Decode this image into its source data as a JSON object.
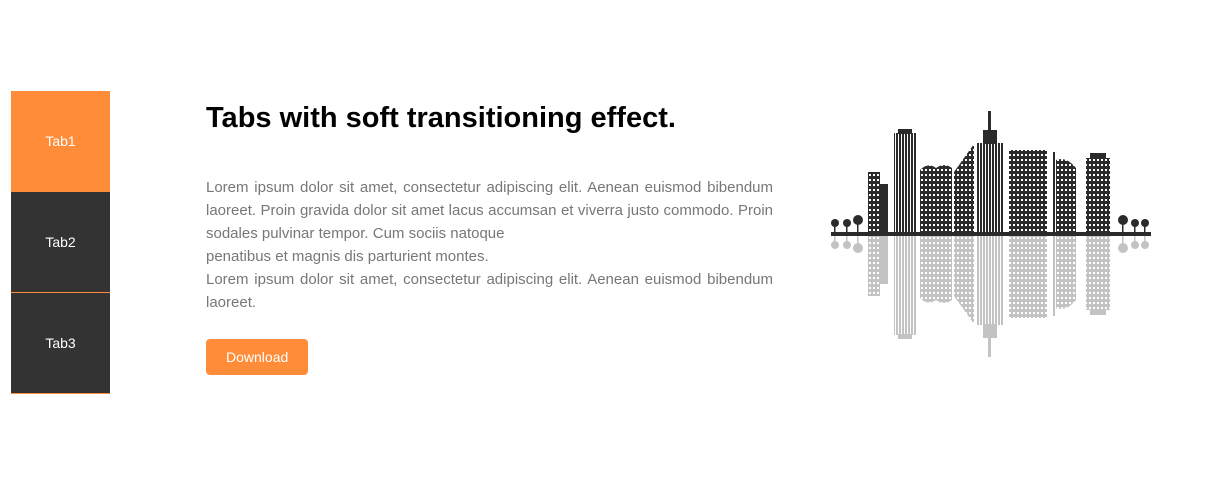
{
  "tabs": [
    {
      "label": "Tab1",
      "active": true
    },
    {
      "label": "Tab2",
      "active": false
    },
    {
      "label": "Tab3",
      "active": false
    }
  ],
  "content": {
    "title": "Tabs with soft transitioning effect.",
    "paragraphs": [
      "Lorem ipsum dolor sit amet, consectetur adipiscing elit. Aenean euismod bibendum laoreet. Proin gravida dolor sit amet lacus accumsan et viverra justo commodo. Proin sodales pulvinar tempor. Cum sociis natoque",
      "penatibus et magnis dis parturient montes.",
      "Lorem ipsum dolor sit amet, consectetur adipiscing elit. Aenean euismod bibendum laoreet."
    ],
    "download_label": "Download"
  },
  "colors": {
    "accent": "#ff8c38",
    "tab_inactive": "#333333",
    "text_muted": "#777777",
    "skyline": "#2b2b2b",
    "reflection": "#cfcfcf"
  },
  "illustration": {
    "icon": "city-skyline-icon"
  }
}
